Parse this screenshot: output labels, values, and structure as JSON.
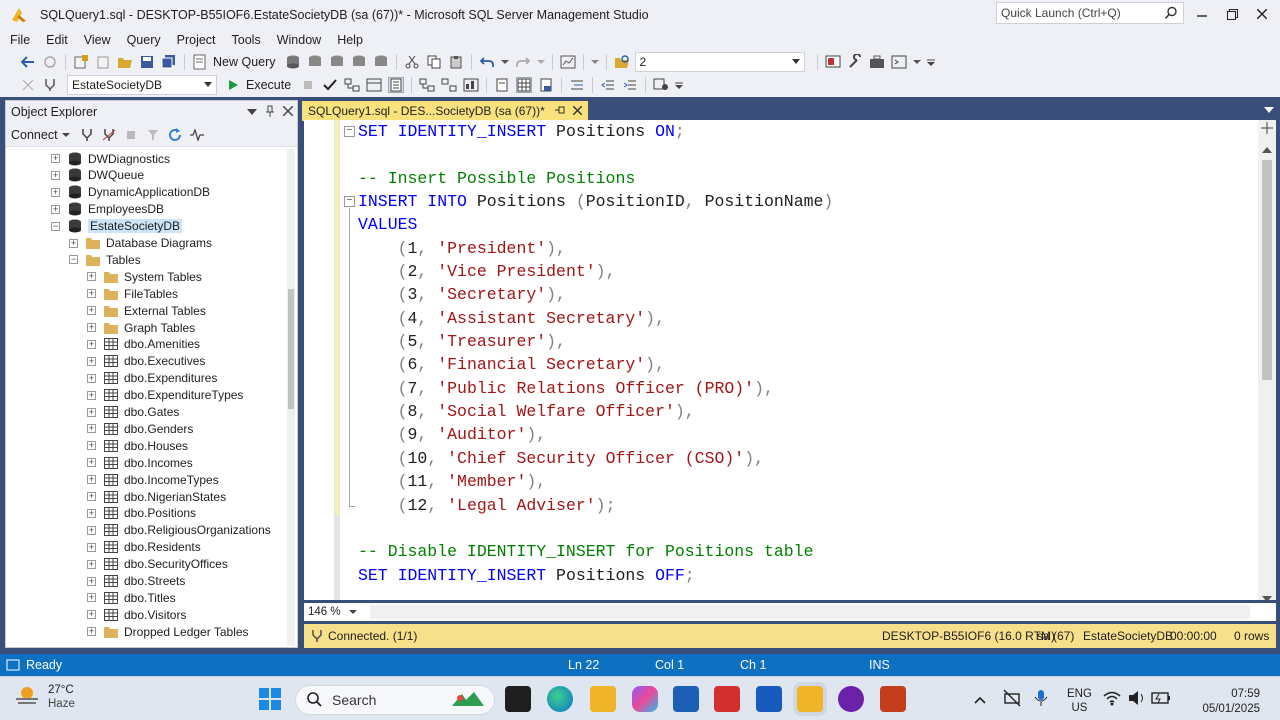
{
  "window": {
    "title": "SQLQuery1.sql - DESKTOP-B55IOF6.EstateSocietyDB (sa (67))* - Microsoft SQL Server Management Studio",
    "quick_launch_placeholder": "Quick Launch (Ctrl+Q)"
  },
  "menu": [
    "File",
    "Edit",
    "View",
    "Query",
    "Project",
    "Tools",
    "Window",
    "Help"
  ],
  "toolbar": {
    "new_query_label": "New Query",
    "results_combo_value": "2",
    "database_combo_value": "EstateSocietyDB",
    "execute_label": "Execute"
  },
  "object_explorer": {
    "title": "Object Explorer",
    "connect_label": "Connect",
    "items": [
      {
        "label": "DWDiagnostics",
        "kind": "db",
        "expander": "+"
      },
      {
        "label": "DWQueue",
        "kind": "db",
        "expander": "+"
      },
      {
        "label": "DynamicApplicationDB",
        "kind": "db",
        "expander": "+"
      },
      {
        "label": "EmployeesDB",
        "kind": "db",
        "expander": "+"
      },
      {
        "label": "EstateSocietyDB",
        "kind": "db",
        "expander": "-",
        "selected": true
      },
      {
        "label": "Database Diagrams",
        "kind": "folder",
        "expander": "+"
      },
      {
        "label": "Tables",
        "kind": "folder",
        "expander": "-"
      },
      {
        "label": "System Tables",
        "kind": "folder",
        "expander": "+"
      },
      {
        "label": "FileTables",
        "kind": "folder",
        "expander": "+"
      },
      {
        "label": "External Tables",
        "kind": "folder",
        "expander": "+"
      },
      {
        "label": "Graph Tables",
        "kind": "folder",
        "expander": "+"
      },
      {
        "label": "dbo.Amenities",
        "kind": "table",
        "expander": "+"
      },
      {
        "label": "dbo.Executives",
        "kind": "table",
        "expander": "+"
      },
      {
        "label": "dbo.Expenditures",
        "kind": "table",
        "expander": "+"
      },
      {
        "label": "dbo.ExpenditureTypes",
        "kind": "table",
        "expander": "+"
      },
      {
        "label": "dbo.Gates",
        "kind": "table",
        "expander": "+"
      },
      {
        "label": "dbo.Genders",
        "kind": "table",
        "expander": "+"
      },
      {
        "label": "dbo.Houses",
        "kind": "table",
        "expander": "+"
      },
      {
        "label": "dbo.Incomes",
        "kind": "table",
        "expander": "+"
      },
      {
        "label": "dbo.IncomeTypes",
        "kind": "table",
        "expander": "+"
      },
      {
        "label": "dbo.NigerianStates",
        "kind": "table",
        "expander": "+"
      },
      {
        "label": "dbo.Positions",
        "kind": "table",
        "expander": "+"
      },
      {
        "label": "dbo.ReligiousOrganizations",
        "kind": "table",
        "expander": "+"
      },
      {
        "label": "dbo.Residents",
        "kind": "table",
        "expander": "+"
      },
      {
        "label": "dbo.SecurityOffices",
        "kind": "table",
        "expander": "+"
      },
      {
        "label": "dbo.Streets",
        "kind": "table",
        "expander": "+"
      },
      {
        "label": "dbo.Titles",
        "kind": "table",
        "expander": "+"
      },
      {
        "label": "dbo.Visitors",
        "kind": "table",
        "expander": "+"
      },
      {
        "label": "Dropped Ledger Tables",
        "kind": "folder",
        "expander": "+"
      }
    ]
  },
  "document_tab": {
    "label": "SQLQuery1.sql - DES...SocietyDB (sa (67))*"
  },
  "editor": {
    "zoom": "146 %",
    "lines": [
      [
        {
          "t": "SET IDENTITY_INSERT",
          "c": "kw"
        },
        {
          "t": " Positions ",
          "c": ""
        },
        {
          "t": "ON",
          "c": "kw"
        },
        {
          "t": ";",
          "c": "op"
        }
      ],
      [],
      [
        {
          "t": "-- Insert Possible Positions",
          "c": "cmt"
        }
      ],
      [
        {
          "t": "INSERT INTO",
          "c": "kw"
        },
        {
          "t": " Positions ",
          "c": ""
        },
        {
          "t": "(",
          "c": "op"
        },
        {
          "t": "PositionID",
          "c": ""
        },
        {
          "t": ",",
          "c": "op"
        },
        {
          "t": " PositionName",
          "c": ""
        },
        {
          "t": ")",
          "c": "op"
        }
      ],
      [
        {
          "t": "VALUES",
          "c": "kw"
        }
      ],
      [
        {
          "t": "    ",
          "c": ""
        },
        {
          "t": "(",
          "c": "op"
        },
        {
          "t": "1",
          "c": ""
        },
        {
          "t": ",",
          "c": "op"
        },
        {
          "t": " ",
          "c": ""
        },
        {
          "t": "'President'",
          "c": "str"
        },
        {
          "t": "),",
          "c": "op"
        }
      ],
      [
        {
          "t": "    ",
          "c": ""
        },
        {
          "t": "(",
          "c": "op"
        },
        {
          "t": "2",
          "c": ""
        },
        {
          "t": ",",
          "c": "op"
        },
        {
          "t": " ",
          "c": ""
        },
        {
          "t": "'Vice President'",
          "c": "str"
        },
        {
          "t": "),",
          "c": "op"
        }
      ],
      [
        {
          "t": "    ",
          "c": ""
        },
        {
          "t": "(",
          "c": "op"
        },
        {
          "t": "3",
          "c": ""
        },
        {
          "t": ",",
          "c": "op"
        },
        {
          "t": " ",
          "c": ""
        },
        {
          "t": "'Secretary'",
          "c": "str"
        },
        {
          "t": "),",
          "c": "op"
        }
      ],
      [
        {
          "t": "    ",
          "c": ""
        },
        {
          "t": "(",
          "c": "op"
        },
        {
          "t": "4",
          "c": ""
        },
        {
          "t": ",",
          "c": "op"
        },
        {
          "t": " ",
          "c": ""
        },
        {
          "t": "'Assistant Secretary'",
          "c": "str"
        },
        {
          "t": "),",
          "c": "op"
        }
      ],
      [
        {
          "t": "    ",
          "c": ""
        },
        {
          "t": "(",
          "c": "op"
        },
        {
          "t": "5",
          "c": ""
        },
        {
          "t": ",",
          "c": "op"
        },
        {
          "t": " ",
          "c": ""
        },
        {
          "t": "'Treasurer'",
          "c": "str"
        },
        {
          "t": "),",
          "c": "op"
        }
      ],
      [
        {
          "t": "    ",
          "c": ""
        },
        {
          "t": "(",
          "c": "op"
        },
        {
          "t": "6",
          "c": ""
        },
        {
          "t": ",",
          "c": "op"
        },
        {
          "t": " ",
          "c": ""
        },
        {
          "t": "'Financial Secretary'",
          "c": "str"
        },
        {
          "t": "),",
          "c": "op"
        }
      ],
      [
        {
          "t": "    ",
          "c": ""
        },
        {
          "t": "(",
          "c": "op"
        },
        {
          "t": "7",
          "c": ""
        },
        {
          "t": ",",
          "c": "op"
        },
        {
          "t": " ",
          "c": ""
        },
        {
          "t": "'Public Relations Officer (PRO)'",
          "c": "str"
        },
        {
          "t": "),",
          "c": "op"
        }
      ],
      [
        {
          "t": "    ",
          "c": ""
        },
        {
          "t": "(",
          "c": "op"
        },
        {
          "t": "8",
          "c": ""
        },
        {
          "t": ",",
          "c": "op"
        },
        {
          "t": " ",
          "c": ""
        },
        {
          "t": "'Social Welfare Officer'",
          "c": "str"
        },
        {
          "t": "),",
          "c": "op"
        }
      ],
      [
        {
          "t": "    ",
          "c": ""
        },
        {
          "t": "(",
          "c": "op"
        },
        {
          "t": "9",
          "c": ""
        },
        {
          "t": ",",
          "c": "op"
        },
        {
          "t": " ",
          "c": ""
        },
        {
          "t": "'Auditor'",
          "c": "str"
        },
        {
          "t": "),",
          "c": "op"
        }
      ],
      [
        {
          "t": "    ",
          "c": ""
        },
        {
          "t": "(",
          "c": "op"
        },
        {
          "t": "10",
          "c": ""
        },
        {
          "t": ",",
          "c": "op"
        },
        {
          "t": " ",
          "c": ""
        },
        {
          "t": "'Chief Security Officer (CSO)'",
          "c": "str"
        },
        {
          "t": "),",
          "c": "op"
        }
      ],
      [
        {
          "t": "    ",
          "c": ""
        },
        {
          "t": "(",
          "c": "op"
        },
        {
          "t": "11",
          "c": ""
        },
        {
          "t": ",",
          "c": "op"
        },
        {
          "t": " ",
          "c": ""
        },
        {
          "t": "'Member'",
          "c": "str"
        },
        {
          "t": "),",
          "c": "op"
        }
      ],
      [
        {
          "t": "    ",
          "c": ""
        },
        {
          "t": "(",
          "c": "op"
        },
        {
          "t": "12",
          "c": ""
        },
        {
          "t": ",",
          "c": "op"
        },
        {
          "t": " ",
          "c": ""
        },
        {
          "t": "'Legal Adviser'",
          "c": "str"
        },
        {
          "t": ");",
          "c": "op"
        }
      ],
      [],
      [
        {
          "t": "-- Disable IDENTITY_INSERT for Positions table",
          "c": "cmt"
        }
      ],
      [
        {
          "t": "SET IDENTITY_INSERT",
          "c": "kw"
        },
        {
          "t": " Positions ",
          "c": ""
        },
        {
          "t": "OFF",
          "c": "kw"
        },
        {
          "t": ";",
          "c": "op"
        }
      ]
    ]
  },
  "query_status": {
    "connected": "Connected. (1/1)",
    "server": "DESKTOP-B55IOF6 (16.0 RTM)",
    "user": "sa (67)",
    "database": "EstateSocietyDB",
    "elapsed": "00:00:00",
    "rows": "0 rows"
  },
  "statusbar": {
    "state": "Ready",
    "ln": "Ln 22",
    "col": "Col 1",
    "ch": "Ch 1",
    "mode": "INS"
  },
  "taskbar": {
    "weather_temp": "27°C",
    "weather_desc": "Haze",
    "search_label": "Search",
    "lang_top": "ENG",
    "lang_bottom": "US",
    "time": "07:59",
    "date": "05/01/2025"
  },
  "colors": {
    "keyword": "#0000ff",
    "string": "#a31515",
    "comment": "#008000",
    "status_blue": "#0e70c0",
    "query_status_yellow": "#f7e08c",
    "active_tab_yellow": "#f9e27d"
  }
}
